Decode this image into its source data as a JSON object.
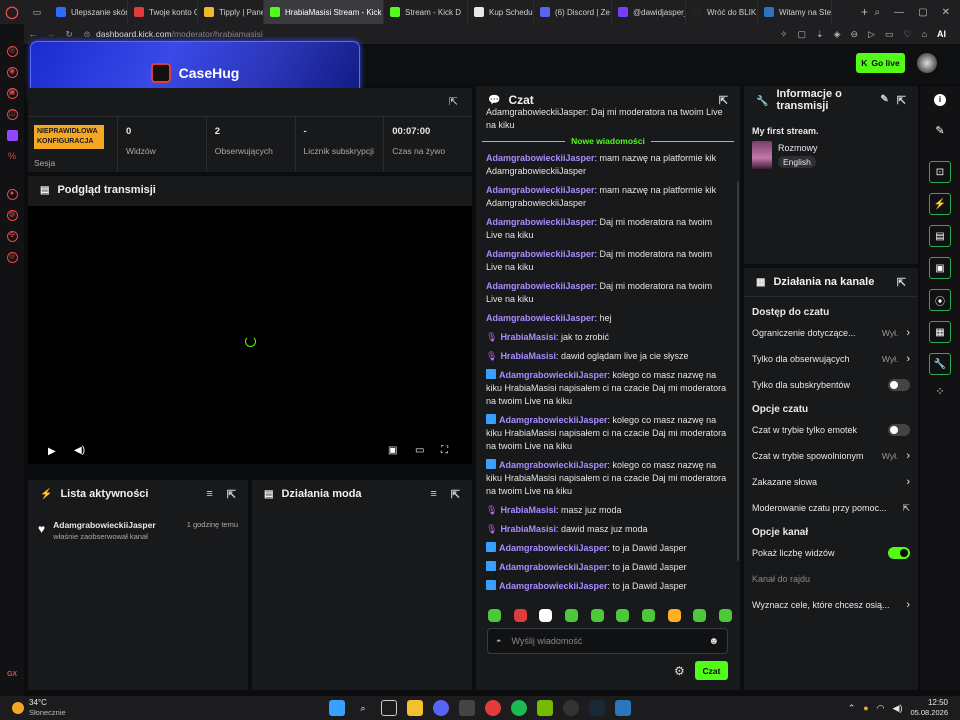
{
  "browser": {
    "tabs": [
      {
        "label": "Ulepszanie skór",
        "color": "#2b6cff"
      },
      {
        "label": "Twoje konto Ca",
        "color": "#e23b3b"
      },
      {
        "label": "Tipply | Panel u",
        "color": "#f2b92b"
      },
      {
        "label": "HrabiaMasisi Stream - Kick",
        "color": "#53fc18"
      },
      {
        "label": "Stream - Kick D",
        "color": "#53fc18"
      },
      {
        "label": "Kup Schedule I",
        "color": "#e8e8e8"
      },
      {
        "label": "(6) Discord | Ze",
        "color": "#5865f2"
      },
      {
        "label": "@dawidjasper_",
        "color": "#7a3cff"
      },
      {
        "label": "Wróć do BLIK",
        "color": "#222222"
      },
      {
        "label": "Witamy na Stea",
        "color": "#2a75bb"
      }
    ],
    "new_tab": "+",
    "url_domain": "dashboard.kick.com",
    "url_path": "/moderator/hrabiamasisi",
    "ai_label": "AI"
  },
  "header": {
    "ad_brand": "CaseHug",
    "go_live": "Go live"
  },
  "stats": {
    "config_badge": "NIEPRAWIDŁOWA KONFIGURACJA",
    "session_label": "Sesja",
    "items": [
      {
        "value": "0",
        "label": "Widzów"
      },
      {
        "value": "2",
        "label": "Obserwujących"
      },
      {
        "value": "-",
        "label": "Licznik subskrypcji"
      },
      {
        "value": "00:07:00",
        "label": "Czas na żywo"
      }
    ]
  },
  "preview": {
    "title": "Podgląd transmisji"
  },
  "activity": {
    "title": "Lista aktywności",
    "items": [
      {
        "user": "AdamgrabowieckiiJasper",
        "time": "1 godzinę temu",
        "text": "właśnie zaobserwował kanał"
      }
    ]
  },
  "modactions": {
    "title": "Działania moda"
  },
  "chat": {
    "title": "Czat",
    "top_fragment": "AdamgrabowieckiiJasper: Daj mi moderatora na twoim Live na kiku",
    "new_messages_label": "Nowe wiadomości",
    "messages": [
      {
        "user": "AdamgrabowieckiiJasper",
        "text": ": mam nazwę na platformie kik AdamgrabowieckiiJasper",
        "badge": ""
      },
      {
        "user": "AdamgrabowieckiiJasper",
        "text": ": mam nazwę na platformie kik AdamgrabowieckiiJasper",
        "badge": ""
      },
      {
        "user": "AdamgrabowieckiiJasper",
        "text": ": Daj mi moderatora na twoim Live na kiku",
        "badge": ""
      },
      {
        "user": "AdamgrabowieckiiJasper",
        "text": ": Daj mi moderatora na twoim Live na kiku",
        "badge": ""
      },
      {
        "user": "AdamgrabowieckiiJasper",
        "text": ": Daj mi moderatora na twoim Live na kiku",
        "badge": ""
      },
      {
        "user": "AdamgrabowieckiiJasper",
        "text": ": hej",
        "badge": ""
      },
      {
        "user": "HrabiaMasisi",
        "text": ": jak to zrobić",
        "badge": "mic"
      },
      {
        "user": "HrabiaMasisi",
        "text": ": dawid oglądam live ja cie słysze",
        "badge": "mic"
      },
      {
        "user": "AdamgrabowieckiiJasper",
        "text": ": kolego co masz nazwę na kiku HrabiaMasisi napisałem ci na czacie Daj mi moderatora na twoim Live na kiku",
        "badge": "mod"
      },
      {
        "user": "AdamgrabowieckiiJasper",
        "text": ": kolego co masz nazwę na kiku HrabiaMasisi napisałem ci na czacie Daj mi moderatora na twoim Live na kiku",
        "badge": "mod"
      },
      {
        "user": "AdamgrabowieckiiJasper",
        "text": ": kolego co masz nazwę na kiku HrabiaMasisi napisałem ci na czacie Daj mi moderatora na twoim Live na kiku",
        "badge": "mod"
      },
      {
        "user": "HrabiaMasisi",
        "text": ": masz juz moda",
        "badge": "mic"
      },
      {
        "user": "HrabiaMasisi",
        "text": ": dawid masz juz moda",
        "badge": "mic"
      },
      {
        "user": "AdamgrabowieckiiJasper",
        "text": ": to ja Dawid Jasper",
        "badge": "mod"
      },
      {
        "user": "AdamgrabowieckiiJasper",
        "text": ": to ja Dawid Jasper",
        "badge": "mod"
      },
      {
        "user": "AdamgrabowieckiiJasper",
        "text": ": to ja Dawid Jasper",
        "badge": "mod"
      }
    ],
    "emotes": [
      "#4cc93a",
      "#e03b3b",
      "#ffffff",
      "#4cc93a",
      "#4cc93a",
      "#4cc93a",
      "#4cc93a",
      "#ffb020",
      "#4cc93a",
      "#4cc93a"
    ],
    "input_placeholder": "Wyślij wiadomość",
    "send_label": "Czat"
  },
  "info": {
    "title": "Informacje o transmisji",
    "stream_title": "My first stream.",
    "category": "Rozmowy",
    "language": "English"
  },
  "channel_actions": {
    "title": "Działania na kanale",
    "access_header": "Dostęp do czatu",
    "access_rows": [
      {
        "label": "Ograniczenie dotyczące...",
        "value": "Wył.",
        "control": "arrow"
      },
      {
        "label": "Tylko dla obserwujących",
        "value": "Wył.",
        "control": "arrow"
      },
      {
        "label": "Tylko dla subskrybentów",
        "value": "",
        "control": "toggle-off"
      }
    ],
    "chat_header": "Opcje czatu",
    "chat_rows": [
      {
        "label": "Czat w trybie tylko emotek",
        "value": "",
        "control": "toggle-off"
      },
      {
        "label": "Czat w trybie spowolnionym",
        "value": "Wył.",
        "control": "arrow"
      },
      {
        "label": "Zakazane słowa",
        "value": "",
        "control": "arrow"
      },
      {
        "label": "Moderowanie czatu przy pomoc...",
        "value": "",
        "control": "external"
      }
    ],
    "channel_header": "Opcje kanał",
    "channel_rows": [
      {
        "label": "Pokaż liczbę widzów",
        "value": "",
        "control": "toggle-on"
      },
      {
        "label": "Kanał do rajdu",
        "value": "",
        "control": "none"
      },
      {
        "label": "Wyznacz cele, które chcesz osią...",
        "value": "",
        "control": "arrow"
      }
    ]
  },
  "taskbar": {
    "weather_temp": "34°C",
    "weather_desc": "Słonecznie",
    "time": "12:50",
    "date": "05.08.2026"
  }
}
